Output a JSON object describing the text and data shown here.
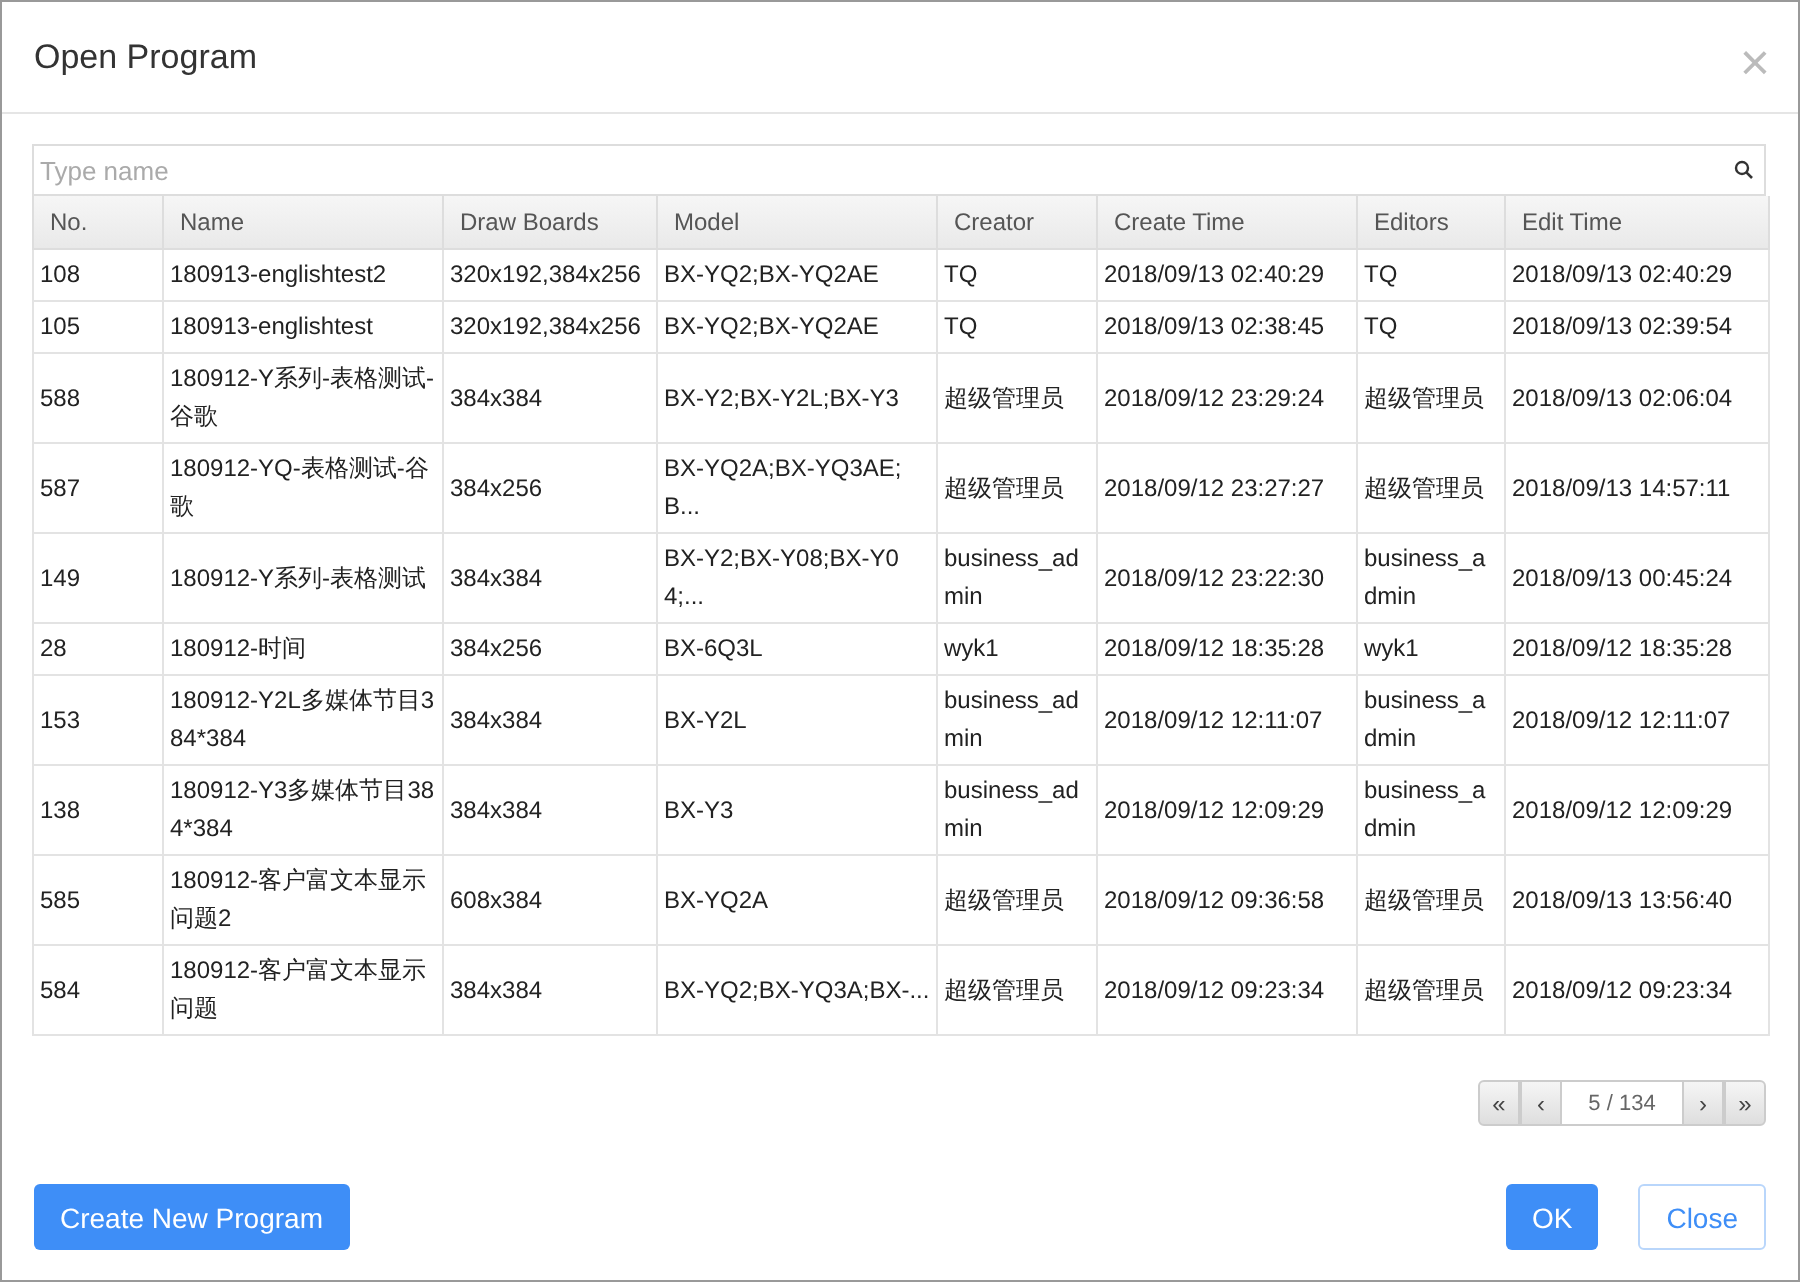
{
  "dialog": {
    "title": "Open Program",
    "close": "×"
  },
  "search": {
    "placeholder": "Type name"
  },
  "table": {
    "columns": [
      "No.",
      "Name",
      "Draw Boards",
      "Model",
      "Creator",
      "Create Time",
      "Editors",
      "Edit Time"
    ],
    "rows": [
      [
        "108",
        "180913-englishtest2",
        "320x192,384x256",
        "BX-YQ2;BX-YQ2AE",
        "TQ",
        "2018/09/13 02:40:29",
        "TQ",
        "2018/09/13 02:40:29"
      ],
      [
        "105",
        "180913-englishtest",
        "320x192,384x256",
        "BX-YQ2;BX-YQ2AE",
        "TQ",
        "2018/09/13 02:38:45",
        "TQ",
        "2018/09/13 02:39:54"
      ],
      [
        "588",
        "180912-Y系列-表格测试-谷歌",
        "384x384",
        "BX-Y2;BX-Y2L;BX-Y3",
        "超级管理员",
        "2018/09/12 23:29:24",
        "超级管理员",
        "2018/09/13 02:06:04"
      ],
      [
        "587",
        "180912-YQ-表格测试-谷歌",
        "384x256",
        "BX-YQ2A;BX-YQ3AE;B...",
        "超级管理员",
        "2018/09/12 23:27:27",
        "超级管理员",
        "2018/09/13 14:57:11"
      ],
      [
        "149",
        "180912-Y系列-表格测试",
        "384x384",
        "BX-Y2;BX-Y08;BX-Y04;...",
        "business_admin",
        "2018/09/12 23:22:30",
        "business_admin",
        "2018/09/13 00:45:24"
      ],
      [
        "28",
        "180912-时间",
        "384x256",
        "BX-6Q3L",
        "wyk1",
        "2018/09/12 18:35:28",
        "wyk1",
        "2018/09/12 18:35:28"
      ],
      [
        "153",
        "180912-Y2L多媒体节目384*384",
        "384x384",
        "BX-Y2L",
        "business_admin",
        "2018/09/12 12:11:07",
        "business_admin",
        "2018/09/12 12:11:07"
      ],
      [
        "138",
        "180912-Y3多媒体节目384*384",
        "384x384",
        "BX-Y3",
        "business_admin",
        "2018/09/12 12:09:29",
        "business_admin",
        "2018/09/12 12:09:29"
      ],
      [
        "585",
        "180912-客户富文本显示问题2",
        "608x384",
        "BX-YQ2A",
        "超级管理员",
        "2018/09/12 09:36:58",
        "超级管理员",
        "2018/09/13 13:56:40"
      ],
      [
        "584",
        "180912-客户富文本显示问题",
        "384x384",
        "BX-YQ2;BX-YQ3A;BX-...",
        "超级管理员",
        "2018/09/12 09:23:34",
        "超级管理员",
        "2018/09/12 09:23:34"
      ]
    ]
  },
  "pagination": {
    "first": "«",
    "prev": "‹",
    "page": "5 / 134",
    "next": "›",
    "last": "»"
  },
  "buttons": {
    "create": "Create New Program",
    "ok": "OK",
    "close": "Close"
  }
}
